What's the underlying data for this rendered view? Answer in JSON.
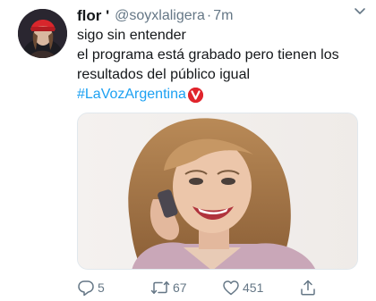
{
  "tweet": {
    "display_name": "flor '",
    "handle": "@soyxlaligera",
    "separator": "·",
    "time": "7m",
    "lines": [
      "sigo sin entender",
      "el programa está grabado pero tienen los",
      "resultados del público igual"
    ],
    "hashtag": "#LaVozArgentina"
  },
  "actions": {
    "reply_count": "5",
    "retweet_count": "67",
    "like_count": "451"
  },
  "colors": {
    "link": "#1da1f2",
    "muted": "#657786",
    "text": "#14171a",
    "badge": "#e0242c"
  },
  "icons": {
    "caret": "chevron-down-icon",
    "reply": "reply-icon",
    "retweet": "retweet-icon",
    "like": "heart-icon",
    "share": "share-icon",
    "badge": "la-voz-logo-icon"
  }
}
